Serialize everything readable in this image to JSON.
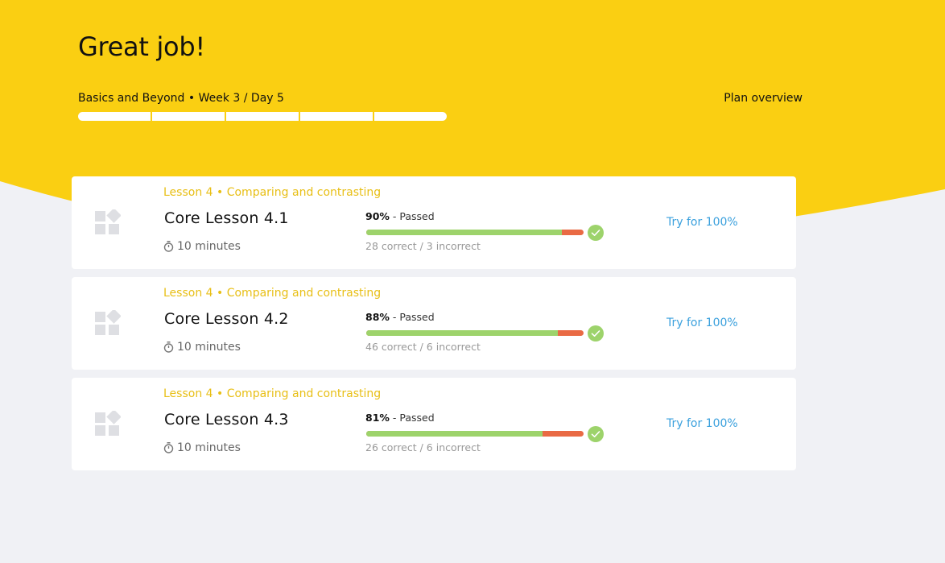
{
  "colors": {
    "header_yellow": "#facf12",
    "background": "#f0f1f5",
    "accent_text": "#e8bf16",
    "link": "#3aa0dd",
    "bar_correct": "#9dd36b",
    "bar_incorrect": "#e96a44",
    "check": "#9dd36b"
  },
  "header": {
    "title": "Great job!",
    "breadcrumb": "Basics and Beyond • Week 3 / Day 5",
    "plan_overview_label": "Plan overview",
    "progress_segments": 5
  },
  "lessons": [
    {
      "meta": "Lesson 4 • Comparing and contrasting",
      "title": "Core Lesson 4.1",
      "duration": "10 minutes",
      "score": "90%",
      "status": " - Passed",
      "counts": "28 correct / 3 incorrect",
      "correct_fraction": 0.9,
      "action": "Try for 100%",
      "icon": "lesson-blocks-icon"
    },
    {
      "meta": "Lesson 4 • Comparing and contrasting",
      "title": "Core Lesson 4.2",
      "duration": "10 minutes",
      "score": "88%",
      "status": " - Passed",
      "counts": "46 correct / 6 incorrect",
      "correct_fraction": 0.88,
      "action": "Try for 100%",
      "icon": "lesson-blocks-icon"
    },
    {
      "meta": "Lesson 4 • Comparing and contrasting",
      "title": "Core Lesson 4.3",
      "duration": "10 minutes",
      "score": "81%",
      "status": " - Passed",
      "counts": "26 correct / 6 incorrect",
      "correct_fraction": 0.81,
      "action": "Try for 100%",
      "icon": "lesson-blocks-icon"
    }
  ]
}
